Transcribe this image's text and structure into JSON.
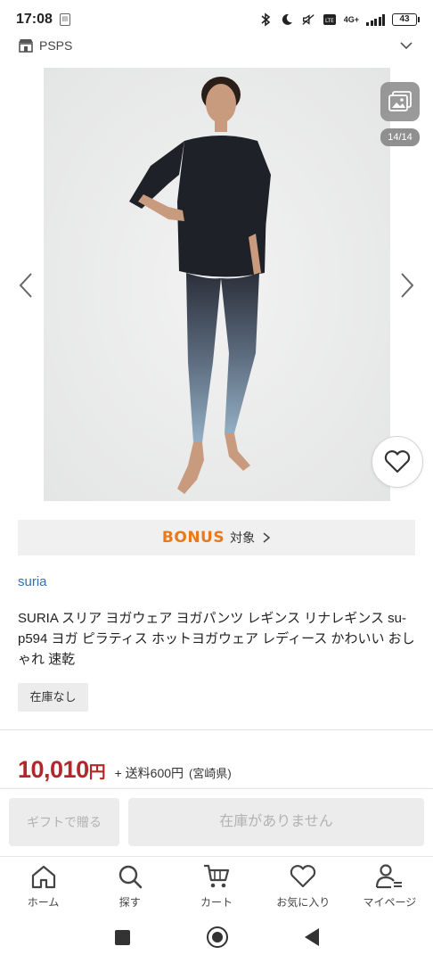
{
  "status_bar": {
    "time": "17:08",
    "network": "4G+",
    "battery": "43"
  },
  "store": {
    "name": "PSPS"
  },
  "gallery": {
    "page_indicator": "14/14"
  },
  "bonus": {
    "logo": "BONUS",
    "label": "対象"
  },
  "product": {
    "brand": "suria",
    "title": "SURIA スリア ヨガウェア ヨガパンツ レギンス リナレギンス su-p594 ヨガ ピラティス ホットヨガウェア レディース かわいい おしゃれ 速乾",
    "stock_status": "在庫なし",
    "price": "10,010",
    "currency": "円",
    "shipping": "+ 送料600円",
    "region": "(宮崎県)"
  },
  "actions": {
    "gift_label": "ギフトで贈る",
    "soldout_label": "在庫がありません"
  },
  "tabs": [
    {
      "label": "ホーム",
      "icon": "home-icon"
    },
    {
      "label": "探す",
      "icon": "search-icon"
    },
    {
      "label": "カート",
      "icon": "cart-icon"
    },
    {
      "label": "お気に入り",
      "icon": "heart-icon"
    },
    {
      "label": "マイページ",
      "icon": "user-icon"
    }
  ],
  "colors": {
    "price": "#b3272b",
    "brand_link": "#2f6fb6",
    "bonus_logo": "#e8791d"
  }
}
